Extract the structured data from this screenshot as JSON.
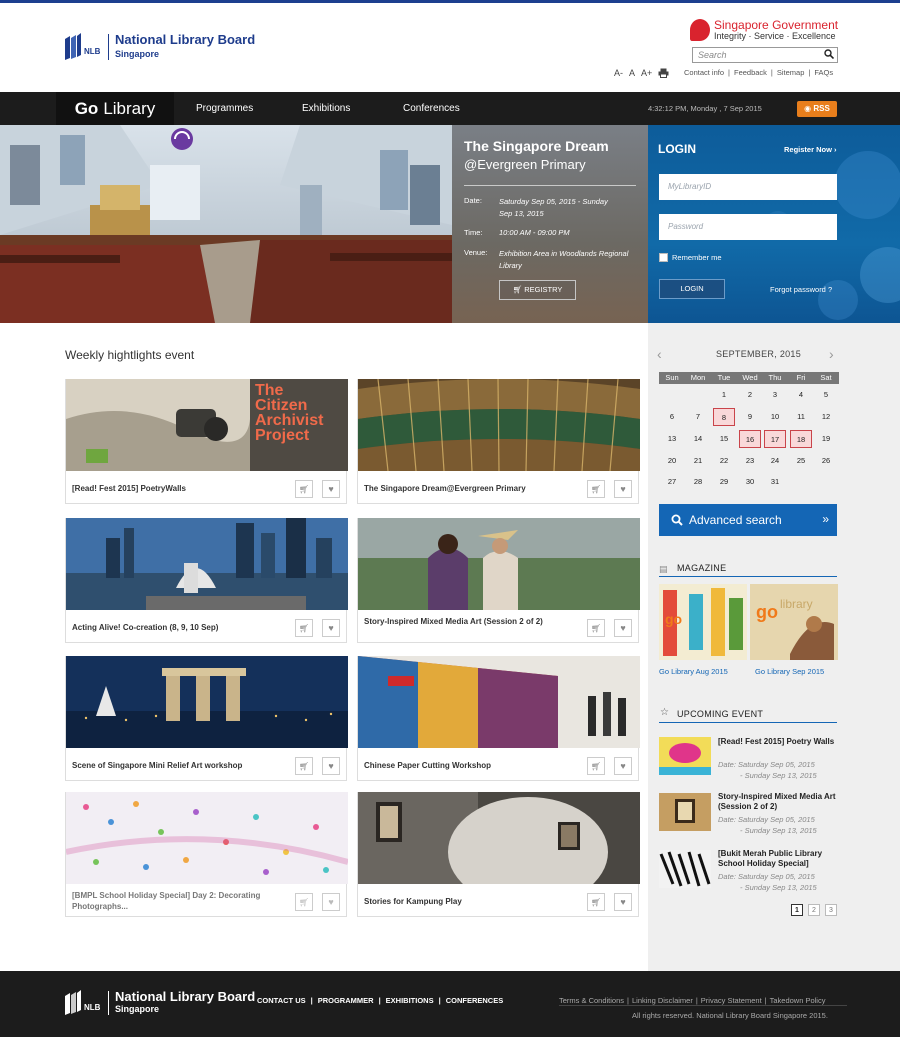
{
  "header": {
    "nlb": {
      "abbr": "NLB",
      "name": "National Library Board",
      "country": "Singapore"
    },
    "gov": {
      "line1": "Singapore",
      "line1b": "Government",
      "line2": "Integrity · Service · Excellence"
    },
    "search_placeholder": "Search",
    "font_tools": [
      "A-",
      "A",
      "A+"
    ],
    "links": [
      "Contact info",
      "Feedback",
      "Sitemap",
      "FAQs"
    ]
  },
  "nav": {
    "brand_bold": "Go",
    "brand_rest": "Library",
    "items": [
      "Programmes",
      "Exhibitions",
      "Conferences"
    ],
    "clock": "4:32:12 PM, Monday , 7 Sep 2015",
    "rss": "RSS"
  },
  "hero": {
    "title": "The Singapore Dream",
    "subtitle": "@Evergreen Primary",
    "date_label": "Date:",
    "date_value": "Saturday Sep 05, 2015 - Sunday Sep 13, 2015",
    "time_label": "Time:",
    "time_value": "10:00 AM - 09:00 PM",
    "venue_label": "Venue:",
    "venue_value": "Exhibition Area in Woodlands Regional Library",
    "button": "REGISTRY"
  },
  "login": {
    "title": "LOGIN",
    "register": "Register Now ›",
    "user_placeholder": "MyLibraryID",
    "pass_placeholder": "Password",
    "remember": "Remember me",
    "button": "LOGIN",
    "forgot": "Forgot password ?"
  },
  "highlights": {
    "title": "Weekly hightlights event",
    "cards": [
      {
        "caption": "[Read! Fest 2015] PoetryWalls",
        "img_text": [
          "The",
          "Citizen",
          "Archivist",
          "Project"
        ]
      },
      {
        "caption": "The Singapore Dream@Evergreen Primary"
      },
      {
        "caption": "Acting Alive! Co-creation (8, 9, 10 Sep)"
      },
      {
        "caption": "Story-Inspired Mixed Media Art (Session 2 of 2)"
      },
      {
        "caption": "Scene of Singapore Mini Relief Art workshop"
      },
      {
        "caption": "Chinese Paper Cutting Workshop"
      },
      {
        "caption": "[BMPL School Holiday Special] Day 2: Decorating Photographs..."
      },
      {
        "caption": "Stories for Kampung Play"
      }
    ]
  },
  "calendar": {
    "month": "SEPTEMBER, 2015",
    "dow": [
      "Sun",
      "Mon",
      "Tue",
      "Wed",
      "Thu",
      "Fri",
      "Sat"
    ],
    "weeks": [
      [
        "",
        "",
        "1",
        "2",
        "3",
        "4",
        "5"
      ],
      [
        "6",
        "7",
        "8",
        "9",
        "10",
        "11",
        "12"
      ],
      [
        "13",
        "14",
        "15",
        "16",
        "17",
        "18",
        "19"
      ],
      [
        "20",
        "21",
        "22",
        "23",
        "24",
        "25",
        "26"
      ],
      [
        "27",
        "28",
        "29",
        "30",
        "31",
        "",
        ""
      ]
    ],
    "highlighted": [
      "8",
      "16",
      "17",
      "18"
    ]
  },
  "advanced_search": "Advanced search",
  "magazine": {
    "title": "MAGAZINE",
    "items": [
      {
        "label": "Go Library Aug 2015",
        "cover_text": "go library"
      },
      {
        "label": "Go Library Sep 2015",
        "cover_text": "go library"
      }
    ]
  },
  "upcoming": {
    "title": "UPCOMING EVENT",
    "items": [
      {
        "title": "[Read! Fest 2015] Poetry Walls",
        "date_label": "Date:",
        "date1": "Saturday Sep 05, 2015",
        "date2": "- Sunday Sep 13, 2015"
      },
      {
        "title": "Story-Inspired Mixed Media Art (Session 2 of 2)",
        "date_label": "Date:",
        "date1": "Saturday Sep 05, 2015",
        "date2": "- Sunday Sep 13, 2015"
      },
      {
        "title": "[Bukit Merah Public Library School Holiday Special]",
        "date_label": "Date:",
        "date1": "Saturday Sep 05, 2015",
        "date2": "- Sunday Sep 13, 2015"
      }
    ],
    "pages": [
      "1",
      "2",
      "3"
    ]
  },
  "footer": {
    "links": [
      "CONTACT US",
      "PROGRAMMER",
      "EXHIBITIONS",
      "CONFERENCES"
    ],
    "right_links": [
      "Terms & Conditions",
      "Linking Disclaimer",
      "Privacy Statement",
      "Takedown Policy"
    ],
    "copyright": "All rights reserved. National Library Board Singapore 2015."
  },
  "colors": {
    "accent": "#1466b5",
    "nav": "#1c1c1c",
    "rss": "#e87e1c",
    "gov_red": "#d9232e"
  }
}
